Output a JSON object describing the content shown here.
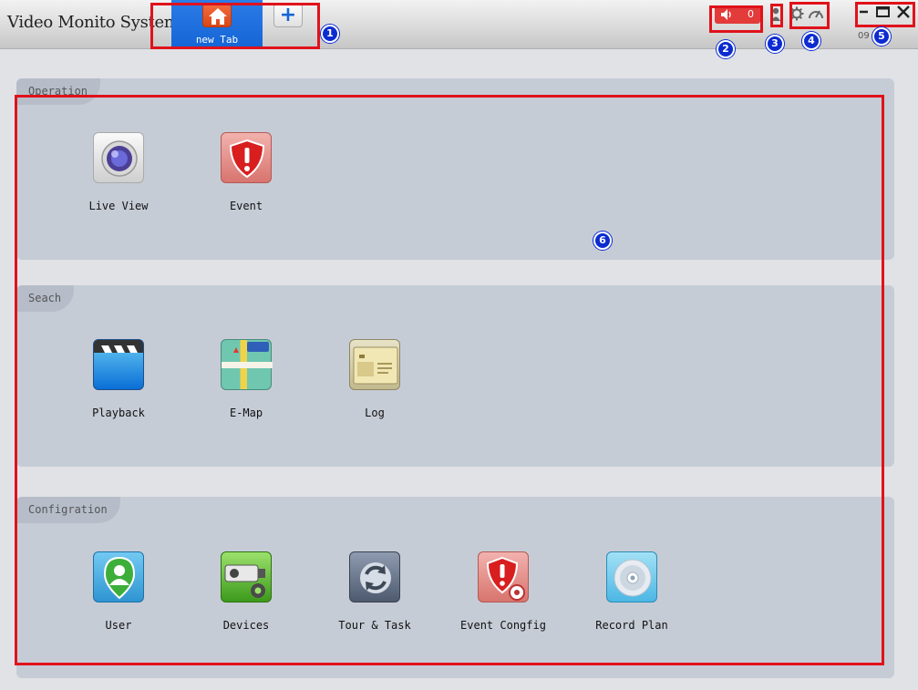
{
  "titlebar": {
    "app_title": "Video Monito System",
    "tab_label": "new Tab",
    "add_tab_symbol": "+",
    "alarm_count": "0",
    "clock": "09   13",
    "icons": [
      "home-icon",
      "speaker-icon",
      "user-icon",
      "gear-icon",
      "performance-icon",
      "minimize-icon",
      "maximize-icon",
      "close-icon"
    ]
  },
  "annotations": {
    "colors": {
      "highlight": "#e0121b",
      "badge": "#0c2bd0"
    },
    "badges": [
      "1",
      "2",
      "3",
      "4",
      "5",
      "6"
    ]
  },
  "sections": {
    "operation": {
      "title": "Operation",
      "items": [
        {
          "label": "Live View",
          "icon": "camera-lens-icon"
        },
        {
          "label": "Event",
          "icon": "alert-shield-icon"
        }
      ]
    },
    "search": {
      "title": "Seach",
      "items": [
        {
          "label": "Playback",
          "icon": "clapperboard-icon"
        },
        {
          "label": "E-Map",
          "icon": "map-icon"
        },
        {
          "label": "Log",
          "icon": "log-book-icon"
        }
      ]
    },
    "configuration": {
      "title": "Configration",
      "items": [
        {
          "label": "User",
          "icon": "user-pin-icon"
        },
        {
          "label": "Devices",
          "icon": "camera-gear-icon"
        },
        {
          "label": "Tour & Task",
          "icon": "refresh-cycle-icon"
        },
        {
          "label": "Event Congfig",
          "icon": "alert-gear-icon"
        },
        {
          "label": "Record Plan",
          "icon": "disc-icon"
        }
      ]
    }
  }
}
